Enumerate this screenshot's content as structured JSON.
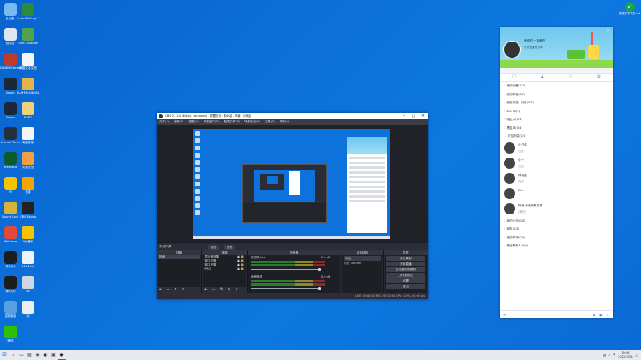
{
  "desktop_icons": [
    {
      "label": "此电脑",
      "color": "#7ab8f0"
    },
    {
      "label": "Smart Defrag 7",
      "color": "#2b8a3e"
    },
    {
      "label": "回收站",
      "color": "#dfe6ef"
    },
    {
      "label": "IObit Unlocker",
      "color": "#4fa34f"
    },
    {
      "label": "AIDA64 Extreme",
      "color": "#c0392b"
    },
    {
      "label": "新建文本文档",
      "color": "#f5f5f5"
    },
    {
      "label": "Steam",
      "color": "#1b2838"
    },
    {
      "label": "PLAYERUNKNOWN'S BATTLEGROUNDS",
      "color": "#e6b34a"
    },
    {
      "label": "Steam",
      "color": "#1b2838"
    },
    {
      "label": "PUBG",
      "color": "#f0d07a"
    },
    {
      "label": "Arsenal Tuner",
      "color": "#25303c"
    },
    {
      "label": "电脑管家",
      "color": "#f5f5f5"
    },
    {
      "label": "Breakout",
      "color": "#0b5c2a"
    },
    {
      "label": "火绒安全",
      "color": "#f0a040"
    },
    {
      "label": "YY",
      "color": "#f5c400"
    },
    {
      "label": "迅雷",
      "color": "#f5a500"
    },
    {
      "label": "Sound Lock",
      "color": "#d9b23c"
    },
    {
      "label": "OBS Studio",
      "color": "#222"
    },
    {
      "label": "WeGame",
      "color": "#e04a3a"
    },
    {
      "label": "QQ音乐",
      "color": "#f5c400"
    },
    {
      "label": "腾讯QQ",
      "color": "#1d1d1d"
    },
    {
      "label": "1111.txt",
      "color": "#eef3fb"
    },
    {
      "label": "腾讯QQ",
      "color": "#1d1d1d"
    },
    {
      "label": "TIM",
      "color": "#d0d7e2"
    },
    {
      "label": "控制面板",
      "color": "#5aa0e0"
    },
    {
      "label": "QQ",
      "color": "#eee"
    },
    {
      "label": "微信",
      "color": "#2dc100"
    }
  ],
  "notify": {
    "label": "新建文本文档.txt"
  },
  "obs": {
    "title": "OBS 27.2.4 (64-bit, windows) - 配置文件: 未命名 - 场景: 未命名",
    "menu": [
      "文件(F)",
      "编辑(E)",
      "视图(V)",
      "停靠窗口(D)",
      "配置文件(P)",
      "场景集合(S)",
      "工具(T)",
      "帮助(H)"
    ],
    "scene_bar_label": "未选择源",
    "scene_bar_buttons": [
      "属性",
      "滤镜"
    ],
    "docks": {
      "scenes": {
        "title": "场景",
        "items": [
          "场景"
        ]
      },
      "sources": {
        "title": "来源",
        "items": [
          "显示器采集",
          "窗口采集",
          "窗口采集",
          "PNG"
        ]
      },
      "mixer": {
        "title": "混音器",
        "channels": [
          {
            "name": "麦克风/Aux",
            "db": "0.0 dB"
          },
          {
            "name": "桌面音频",
            "db": "0.0 dB"
          }
        ]
      },
      "transitions": {
        "title": "转场特效",
        "type": "淡出",
        "duration_label": "时长",
        "duration": "300 ms"
      },
      "controls": {
        "title": "控件",
        "buttons": [
          "停止录制",
          "开始直播",
          "启动虚拟摄像机",
          "工作室模式",
          "设置",
          "退出"
        ]
      }
    },
    "status": "LIVE: 00:00:00   REC: 00:00:00   CPU: 0.9%, 60.00 fps"
  },
  "qq": {
    "name": "爱你的·一直都在",
    "signature": "今天也要开心呀",
    "tabs": [
      "消息",
      "联系人",
      "空间",
      "更多"
    ],
    "groups": [
      {
        "label": "我的设备(2/2)",
        "open": false
      },
      {
        "label": "我的好友(0/7)",
        "open": false
      },
      {
        "label": "朋友家族，网友(5/7)",
        "open": false
      },
      {
        "label": "LOL (0/3)",
        "open": false
      },
      {
        "label": "陌生人(0/3)",
        "open": false
      },
      {
        "label": "黑名单(0/4)",
        "open": false
      },
      {
        "label": "好友列表(1/1)",
        "open": true
      }
    ],
    "friends": [
      {
        "name": "小白菜",
        "status": "在线"
      },
      {
        "name": "小一",
        "status": "在线"
      },
      {
        "name": "林晓晨",
        "status": "在线"
      },
      {
        "name": "Eta",
        "status": ""
      },
      {
        "name": "阿雨·未来的某某某",
        "status": "[离开]"
      }
    ],
    "groups_after": [
      {
        "label": "我的企业(0/0)"
      },
      {
        "label": "朋友(0/2)"
      },
      {
        "label": "我的同学(0/0)"
      },
      {
        "label": "最近联系人(0/0)"
      }
    ],
    "footer": "查找"
  },
  "taskbar": {
    "time": "19:08",
    "date": "2022/3/26",
    "lang": "中"
  }
}
